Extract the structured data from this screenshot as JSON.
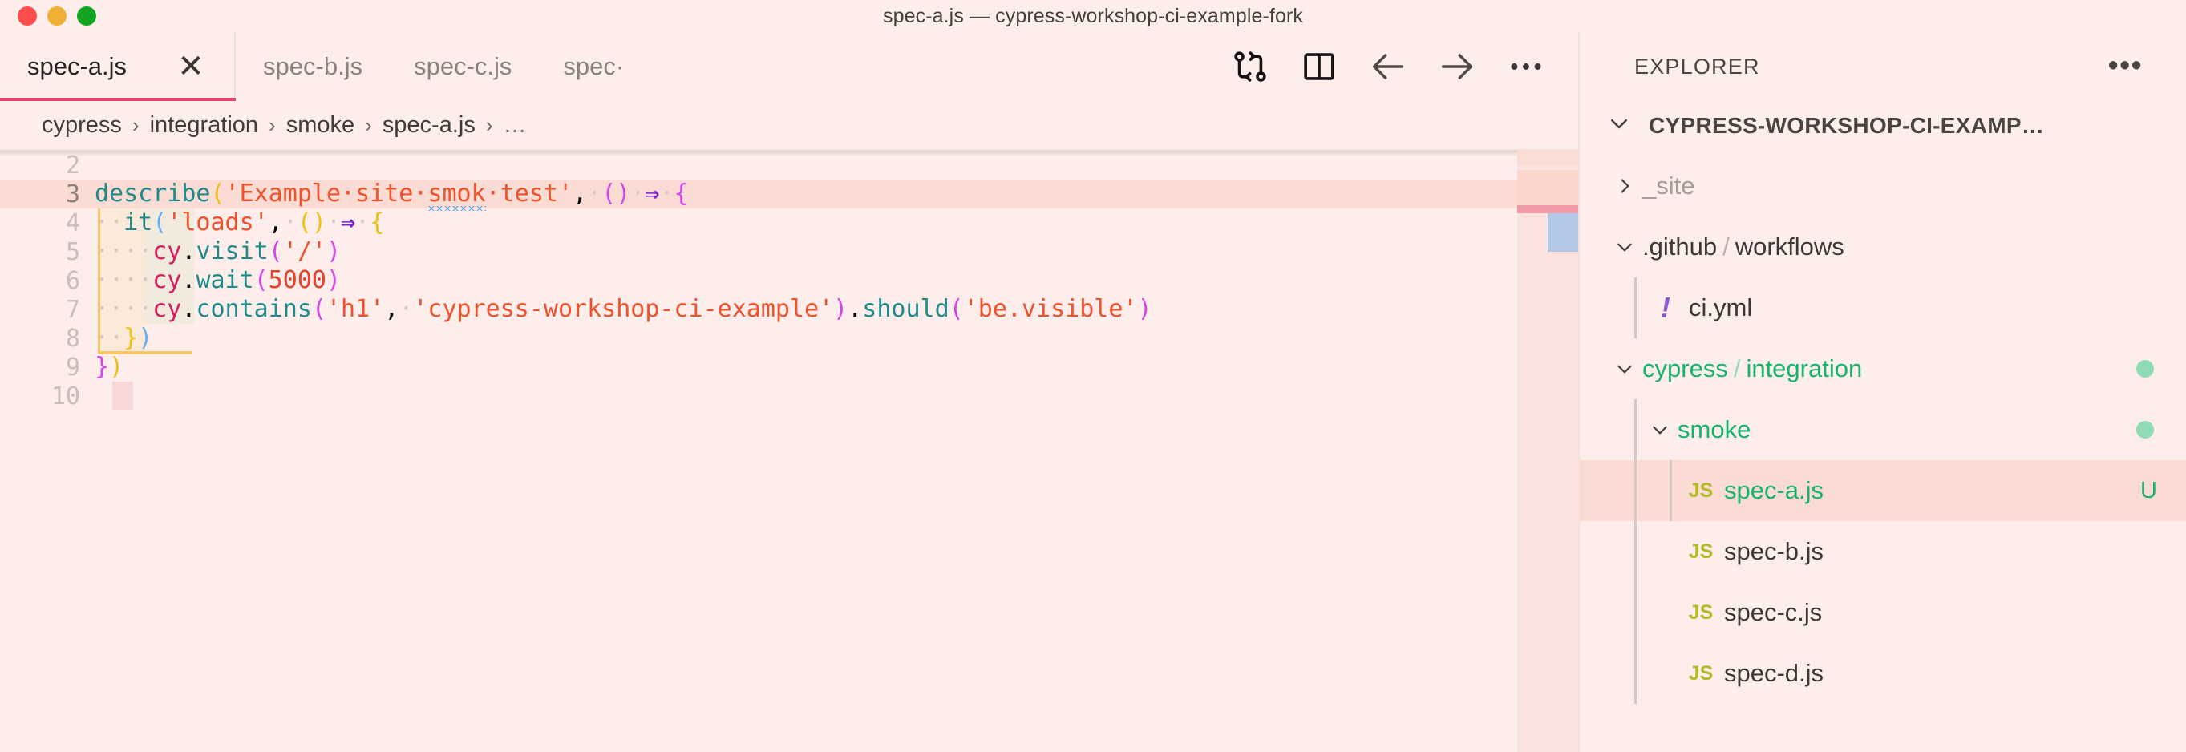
{
  "window": {
    "title": "spec-a.js — cypress-workshop-ci-example-fork",
    "traffic_lights": [
      {
        "name": "close",
        "color": "#fc4c4c"
      },
      {
        "name": "minimize",
        "color": "#efb034"
      },
      {
        "name": "zoom",
        "color": "#12a321"
      }
    ]
  },
  "tabs": [
    {
      "label": "spec-a.js",
      "active": true,
      "close_glyph": "✕"
    },
    {
      "label": "spec-b.js",
      "active": false
    },
    {
      "label": "spec-c.js",
      "active": false
    },
    {
      "label": "spec·",
      "active": false
    }
  ],
  "tab_actions": [
    {
      "name": "git-compare-icon",
      "title": "Compare Changes"
    },
    {
      "name": "split-editor-icon",
      "title": "Split Editor"
    },
    {
      "name": "arrow-left-icon",
      "title": "Go Back"
    },
    {
      "name": "arrow-right-icon",
      "title": "Go Forward"
    },
    {
      "name": "more-actions-icon",
      "title": "More Actions...",
      "glyph": "•••"
    }
  ],
  "breadcrumb": {
    "separator": "›",
    "items": [
      "cypress",
      "integration",
      "smoke",
      "spec-a.js",
      "…"
    ]
  },
  "editor": {
    "language": "javascript",
    "first_visible_line": 2,
    "last_visible_line": 10,
    "current_line": 3,
    "lines": [
      {
        "number": "2",
        "text": "",
        "highlighted": false
      },
      {
        "number": "3",
        "text": "describe('Example site smok test', () => {",
        "highlighted": true
      },
      {
        "number": "4",
        "text": "  it('loads', () => {",
        "highlighted": false
      },
      {
        "number": "5",
        "text": "    cy.visit('/')",
        "highlighted": false
      },
      {
        "number": "6",
        "text": "    cy.wait(5000)",
        "highlighted": false
      },
      {
        "number": "7",
        "text": "    cy.contains('h1', 'cypress-workshop-ci-example').should('be.visible')",
        "highlighted": false
      },
      {
        "number": "8",
        "text": "  })",
        "highlighted": false
      },
      {
        "number": "9",
        "text": "})",
        "highlighted": false
      },
      {
        "number": "10",
        "text": "",
        "highlighted": false
      }
    ],
    "tokens": {
      "describe": "describe",
      "it": "it",
      "str_describe_pre": "'Example·site·",
      "str_smok": "smok",
      "str_describe_post": "·test'",
      "str_loads": "'loads'",
      "cy": "cy",
      "dot": ".",
      "visit": "visit",
      "wait": "wait",
      "contains": "contains",
      "should": "should",
      "str_slash": "'/'",
      "num_5000": "5000",
      "str_h1": "'h1'",
      "str_title": "'cypress-workshop-ci-example'",
      "str_visible": "'be.visible'",
      "arrow": "⇒",
      "comma": ",",
      "paren_open": "(",
      "paren_close": ")",
      "brace_open": "{",
      "brace_close": "}",
      "ws_dot": "·"
    },
    "misspelled_word": "smok"
  },
  "sidebar": {
    "title": "EXPLORER",
    "more_glyph": "•••",
    "root": {
      "label": "CYPRESS-WORKSHOP-CI-EXAMP…",
      "expanded": true,
      "chevron": "∨"
    },
    "tree": [
      {
        "name": "_site",
        "label": "_site",
        "kind": "folder",
        "expanded": false,
        "chevron": "›",
        "depth": 1,
        "dimmed": true,
        "icon": null,
        "badge": null
      },
      {
        "name": "github-workflows",
        "label": ".github",
        "sublabel": "workflows",
        "kind": "folder",
        "expanded": true,
        "chevron": "∨",
        "depth": 1,
        "dimmed": false,
        "icon": null,
        "badge": null
      },
      {
        "name": "ci-yml",
        "label": "ci.yml",
        "kind": "file",
        "depth": 2,
        "icon": "yaml-icon",
        "icon_text": "!",
        "badge": null,
        "dimmed": false
      },
      {
        "name": "cypress-integration",
        "label": "cypress",
        "sublabel": "integration",
        "kind": "folder",
        "expanded": true,
        "chevron": "∨",
        "depth": 1,
        "dimmed": false,
        "icon": null,
        "badge": "dot",
        "color": "green"
      },
      {
        "name": "smoke",
        "label": "smoke",
        "kind": "folder",
        "expanded": true,
        "chevron": "∨",
        "depth": 2,
        "dimmed": false,
        "icon": null,
        "badge": "dot",
        "color": "green"
      },
      {
        "name": "spec-a-js",
        "label": "spec-a.js",
        "kind": "file",
        "depth": 3,
        "icon": "js-icon",
        "icon_text": "JS",
        "badge": "U",
        "color": "green",
        "selected": true
      },
      {
        "name": "spec-b-js",
        "label": "spec-b.js",
        "kind": "file",
        "depth": 3,
        "icon": "js-icon",
        "icon_text": "JS",
        "badge": null
      },
      {
        "name": "spec-c-js",
        "label": "spec-c.js",
        "kind": "file",
        "depth": 3,
        "icon": "js-icon",
        "icon_text": "JS",
        "badge": null
      },
      {
        "name": "spec-d-js",
        "label": "spec-d.js",
        "kind": "file",
        "depth": 3,
        "icon": "js-icon",
        "icon_text": "JS",
        "badge": null
      }
    ]
  },
  "theme": {
    "background": "#fdeeeb",
    "active_tab_border": "#e8446e",
    "line_highlight": "#fadcd4",
    "selection": "#fbdcd5",
    "function_color": "#1f8a8a",
    "string_color": "#f0502a",
    "number_color": "#e8402a",
    "object_color": "#d81b60",
    "arrow_color": "#7b1fd1",
    "git_untracked": "#16b36b",
    "js_icon_color": "#b0bb26",
    "yaml_icon_color": "#8f57d6"
  }
}
